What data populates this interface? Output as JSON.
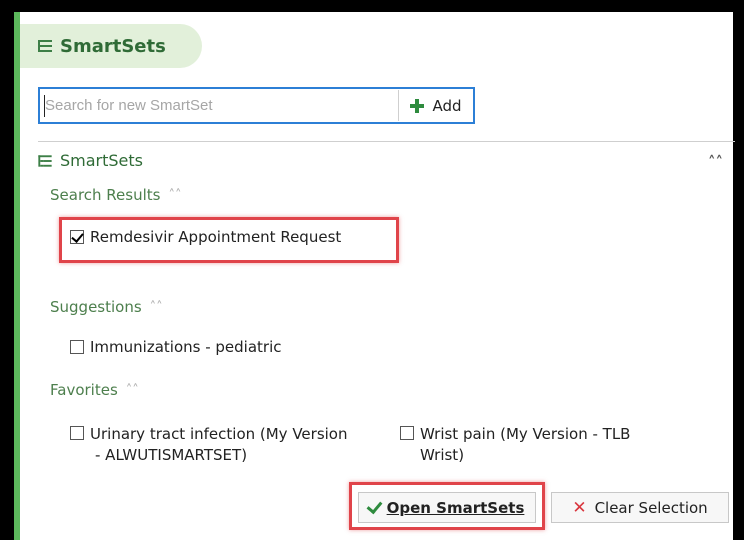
{
  "header": {
    "title": "SmartSets"
  },
  "search": {
    "placeholder": "Search for new SmartSet",
    "value": "",
    "add_label": "Add"
  },
  "section": {
    "title": "SmartSets"
  },
  "groups": {
    "search_results": {
      "heading": "Search Results",
      "items": [
        {
          "label": "Remdesivir Appointment Request",
          "checked": true
        }
      ]
    },
    "suggestions": {
      "heading": "Suggestions",
      "items": [
        {
          "label": "Immunizations - pediatric",
          "checked": false
        }
      ]
    },
    "favorites": {
      "heading": "Favorites",
      "items": [
        {
          "label_line1": "Urinary tract infection (My Version",
          "label_line2": "- ALWUTISMARTSET)",
          "checked": false
        },
        {
          "label_line1": "Wrist pain (My Version - TLB",
          "label_line2": "Wrist)",
          "checked": false
        }
      ]
    }
  },
  "footer": {
    "open_label": "Open SmartSets",
    "clear_label": "Clear Selection"
  },
  "colors": {
    "accent_green": "#5cb85c",
    "focus_blue": "#2c7fd6",
    "highlight_red": "#e0444a"
  },
  "icons": {
    "header": "list-icon",
    "add": "plus-icon",
    "collapse": "double-chevron-up-icon",
    "open": "checkmark-icon",
    "clear": "x-icon"
  }
}
